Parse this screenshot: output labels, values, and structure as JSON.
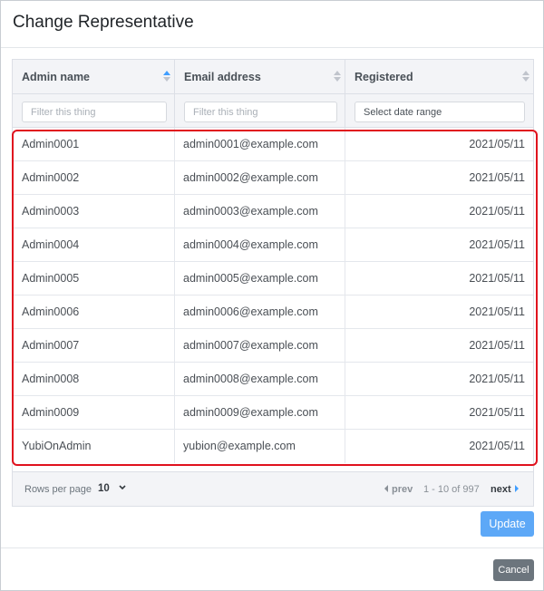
{
  "modal": {
    "title": "Change Representative"
  },
  "table": {
    "columns": [
      {
        "label": "Admin name",
        "sort": "ascending"
      },
      {
        "label": "Email address",
        "sort": "none"
      },
      {
        "label": "Registered",
        "sort": "none"
      }
    ],
    "filters": {
      "admin_name_placeholder": "Filter this thing",
      "email_placeholder": "Filter this thing",
      "registered_placeholder": "Select date range"
    },
    "rows": [
      {
        "name": "Admin0001",
        "email": "admin0001@example.com",
        "registered": "2021/05/11"
      },
      {
        "name": "Admin0002",
        "email": "admin0002@example.com",
        "registered": "2021/05/11"
      },
      {
        "name": "Admin0003",
        "email": "admin0003@example.com",
        "registered": "2021/05/11"
      },
      {
        "name": "Admin0004",
        "email": "admin0004@example.com",
        "registered": "2021/05/11"
      },
      {
        "name": "Admin0005",
        "email": "admin0005@example.com",
        "registered": "2021/05/11"
      },
      {
        "name": "Admin0006",
        "email": "admin0006@example.com",
        "registered": "2021/05/11"
      },
      {
        "name": "Admin0007",
        "email": "admin0007@example.com",
        "registered": "2021/05/11"
      },
      {
        "name": "Admin0008",
        "email": "admin0008@example.com",
        "registered": "2021/05/11"
      },
      {
        "name": "Admin0009",
        "email": "admin0009@example.com",
        "registered": "2021/05/11"
      },
      {
        "name": "YubiOnAdmin",
        "email": "yubion@example.com",
        "registered": "2021/05/11"
      }
    ],
    "footer": {
      "rows_per_page_label": "Rows per page",
      "rows_per_page_value": "10",
      "prev_label": "prev",
      "page_info": "1 - 10 of 997",
      "next_label": "next"
    }
  },
  "buttons": {
    "update": "Update",
    "cancel": "Cancel"
  },
  "colors": {
    "accent": "#409eff",
    "update_button": "#5da8f7",
    "cancel_button": "#6c757d",
    "highlight": "#e0121e"
  }
}
